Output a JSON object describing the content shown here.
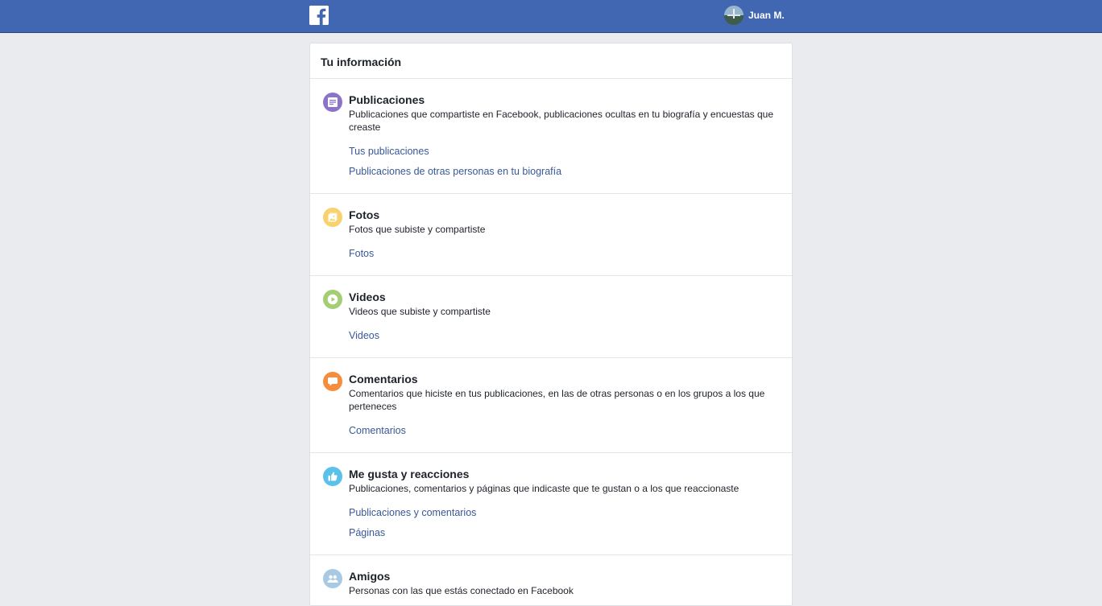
{
  "topbar": {
    "user_name": "Juan M."
  },
  "card": {
    "title": "Tu información"
  },
  "sections": [
    {
      "icon": "posts-icon",
      "color": "#8c72cb",
      "title": "Publicaciones",
      "description": "Publicaciones que compartiste en Facebook, publicaciones ocultas en tu biografía y encuestas que creaste",
      "links": [
        "Tus publicaciones",
        "Publicaciones de otras personas en tu biografía"
      ]
    },
    {
      "icon": "photos-icon",
      "color": "#f7d26f",
      "title": "Fotos",
      "description": "Fotos que subiste y compartiste",
      "links": [
        "Fotos"
      ]
    },
    {
      "icon": "videos-icon",
      "color": "#a3ce71",
      "title": "Videos",
      "description": "Videos que subiste y compartiste",
      "links": [
        "Videos"
      ]
    },
    {
      "icon": "comments-icon",
      "color": "#f68d3c",
      "title": "Comentarios",
      "description": "Comentarios que hiciste en tus publicaciones, en las de otras personas o en los grupos a los que perteneces",
      "links": [
        "Comentarios"
      ]
    },
    {
      "icon": "likes-icon",
      "color": "#5ac1ea",
      "title": "Me gusta y reacciones",
      "description": "Publicaciones, comentarios y páginas que indicaste que te gustan o a los que reaccionaste",
      "links": [
        "Publicaciones y comentarios",
        "Páginas"
      ]
    },
    {
      "icon": "friends-icon",
      "color": "#a8c9e3",
      "title": "Amigos",
      "description": "Personas con las que estás conectado en Facebook",
      "links": []
    }
  ],
  "colors": {
    "topbar": "#4267b2",
    "link": "#385898",
    "background": "#e9ebee"
  }
}
